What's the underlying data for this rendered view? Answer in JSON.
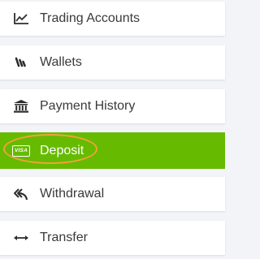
{
  "menu": {
    "items": [
      {
        "label": "Trading Accounts",
        "icon": "chart-line-icon"
      },
      {
        "label": "Wallets",
        "icon": "wallet-icon"
      },
      {
        "label": "Payment History",
        "icon": "bank-icon"
      },
      {
        "label": "Deposit",
        "icon": "visa-card-icon",
        "icon_text": "VISA",
        "active": true
      },
      {
        "label": "Withdrawal",
        "icon": "reply-arrow-icon"
      },
      {
        "label": "Transfer",
        "icon": "left-right-arrow-icon"
      }
    ]
  },
  "colors": {
    "active_bg": "#66bb00",
    "highlight_ring": "#f2a23a",
    "item_bg": "#ffffff",
    "page_bg": "#f2f4f7",
    "text": "#3a3a3a",
    "icon": "#2d2d2d"
  }
}
